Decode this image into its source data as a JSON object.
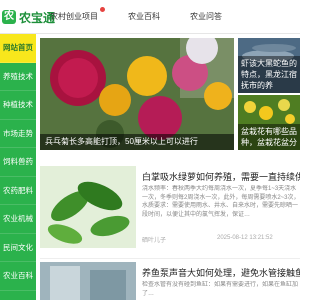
{
  "header": {
    "logo_text": "农宝通",
    "logo_mark": "农",
    "nav": [
      {
        "label": "农村创业项目"
      },
      {
        "label": "农业百科"
      },
      {
        "label": "农业问答"
      }
    ]
  },
  "sidebar": {
    "items": [
      {
        "label": "网站首页"
      },
      {
        "label": "养殖技术"
      },
      {
        "label": "种植技术"
      },
      {
        "label": "市场走势"
      },
      {
        "label": "饲料兽药"
      },
      {
        "label": "农药肥料"
      },
      {
        "label": "农业机械"
      },
      {
        "label": "民间文化"
      },
      {
        "label": "农业百科"
      }
    ]
  },
  "hero": {
    "caption": "兵乓菊长多高能打顶，50厘米以上可以进行"
  },
  "side_cards": [
    {
      "caption": "虾该大黑蛇鱼的特点，黑龙江宿抚市的养"
    },
    {
      "caption": "盆栽花有哪些品种，盆栽花盆分"
    }
  ],
  "articles": [
    {
      "title": "白掌吸水绿萝如何养殖，需要一直持续供水",
      "summary": "浇水频率：春秋两季大约每周浇水一次，夏季每1~3天浇水一次，冬季则每2周浇水一次，此外，每周需要喷水2~3次，水质要求：需要使用雨水、井水、自来水时，需要先晾晒一段时间，以便让其中的氯气挥发，保证…",
      "author": "硒叶儿子",
      "date": "2025-08-12 13:21:52"
    },
    {
      "title": "养鱼泵声音大如何处理，避免水管接触鱼缸就不会产生",
      "summary": "检查水管有没有碰到鱼缸：如果有需要进行，如果在鱼缸加了…",
      "author": "",
      "date": ""
    }
  ],
  "colors": {
    "brand_green": "#2bb24c",
    "active_yellow": "#f8e71c"
  }
}
